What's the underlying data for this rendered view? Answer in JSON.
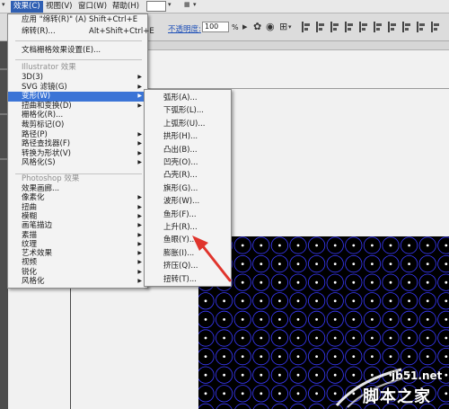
{
  "menubar": {
    "items": [
      {
        "label": "效果(C)",
        "active": true
      },
      {
        "label": "视图(V)",
        "active": false
      },
      {
        "label": "窗口(W)",
        "active": false
      },
      {
        "label": "帮助(H)",
        "active": false
      }
    ]
  },
  "controlbar": {
    "opacity_label": "不透明度:",
    "opacity_value": "100",
    "opacity_unit": "%"
  },
  "effect_menu": {
    "top_items": [
      {
        "label": "应用 \"绵转(R)\" (A)",
        "shortcut": "Shift+Ctrl+E"
      },
      {
        "label": "绵转(R)...",
        "shortcut": "Alt+Shift+Ctrl+E"
      },
      {
        "label": "文档栅格效果设置(E)...",
        "shortcut": ""
      }
    ],
    "illustrator_header": "Illustrator 效果",
    "illustrator_items": [
      {
        "label": "3D(3)",
        "submenu": true,
        "highlighted": false
      },
      {
        "label": "SVG 滤镜(G)",
        "submenu": true,
        "highlighted": false
      },
      {
        "label": "变形(W)",
        "submenu": true,
        "highlighted": true
      },
      {
        "label": "扭曲和变换(D)",
        "submenu": true,
        "highlighted": false
      },
      {
        "label": "栅格化(R)...",
        "submenu": false,
        "highlighted": false
      },
      {
        "label": "裁剪标记(O)",
        "submenu": false,
        "highlighted": false
      },
      {
        "label": "路径(P)",
        "submenu": true,
        "highlighted": false
      },
      {
        "label": "路径查找器(F)",
        "submenu": true,
        "highlighted": false
      },
      {
        "label": "转换为形状(V)",
        "submenu": true,
        "highlighted": false
      },
      {
        "label": "风格化(S)",
        "submenu": true,
        "highlighted": false
      }
    ],
    "photoshop_header": "Photoshop 效果",
    "photoshop_items": [
      {
        "label": "效果画廊...",
        "submenu": false
      },
      {
        "label": "像素化",
        "submenu": true
      },
      {
        "label": "扭曲",
        "submenu": true
      },
      {
        "label": "模糊",
        "submenu": true
      },
      {
        "label": "画笔描边",
        "submenu": true
      },
      {
        "label": "素描",
        "submenu": true
      },
      {
        "label": "纹理",
        "submenu": true
      },
      {
        "label": "艺术效果",
        "submenu": true
      },
      {
        "label": "视频",
        "submenu": true
      },
      {
        "label": "锐化",
        "submenu": true
      },
      {
        "label": "风格化",
        "submenu": true
      }
    ]
  },
  "warp_menu": {
    "items": [
      "弧形(A)...",
      "下弧形(L)...",
      "上弧形(U)...",
      "拱形(H)...",
      "凸出(B)...",
      "凹壳(O)...",
      "凸壳(R)...",
      "旗形(G)...",
      "波形(W)...",
      "鱼形(F)...",
      "上升(R)...",
      "鱼眼(Y)...",
      "膨胀(I)...",
      "挤压(Q)...",
      "扭转(T)..."
    ]
  },
  "artwork": {
    "dot_color": "#ffffff",
    "ring_color": "#3a3aff",
    "background": "#000000"
  },
  "watermark": {
    "url": "jb51.net",
    "name": "脚本之家"
  },
  "colors": {
    "menu_highlight": "#3b74d6",
    "menubar_active": "#2f5fb3",
    "annotation_arrow": "#e0342c"
  }
}
